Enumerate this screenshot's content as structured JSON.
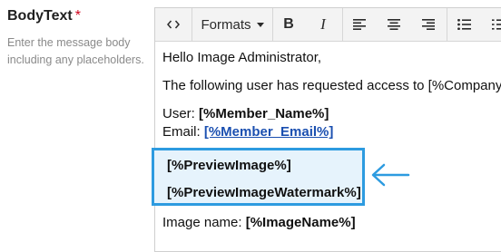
{
  "field": {
    "label": "BodyText",
    "required_mark": "*",
    "help_text": "Enter the message body including any placeholders."
  },
  "toolbar": {
    "source_code": "source-code-icon",
    "formats_label": "Formats",
    "bold": "B",
    "italic": "I",
    "align_left": "align-left-icon",
    "align_center": "align-center-icon",
    "align_right": "align-right-icon",
    "bullet_list": "bullet-list-icon",
    "numbered_list": "numbered-list-icon"
  },
  "body": {
    "greeting": "Hello Image Administrator,",
    "intro": "The following user has requested access to [%CompanyName%]",
    "user_label": "User: ",
    "user_value": "[%Member_Name%]",
    "email_label": "Email: ",
    "email_value": "[%Member_Email%]",
    "preview_image": "[%PreviewImage%]",
    "preview_watermark": "[%PreviewImageWatermark%]",
    "image_name_label": "Image name: ",
    "image_name_value": "[%ImageName%]"
  },
  "colors": {
    "highlight_border": "#2d9be0",
    "highlight_fill": "#e6f3fc",
    "link": "#1a4fb0",
    "required": "#d0021b",
    "arrow": "#2d9be0"
  },
  "icons": {
    "callout_arrow": "left-arrow-icon"
  }
}
